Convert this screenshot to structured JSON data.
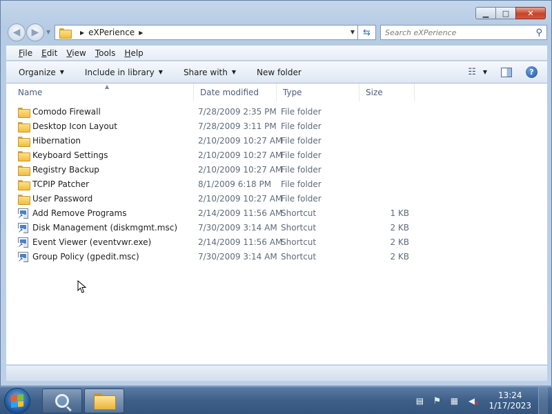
{
  "window": {
    "minimize_glyph": "▁",
    "maximize_glyph": "□",
    "close_glyph": "✕"
  },
  "address_bar": {
    "path": [
      "eXPerience"
    ],
    "search_placeholder": "Search eXPerience"
  },
  "menu": [
    {
      "label": "File",
      "accel": "F",
      "rest": "ile"
    },
    {
      "label": "Edit",
      "accel": "E",
      "rest": "dit"
    },
    {
      "label": "View",
      "accel": "V",
      "rest": "iew"
    },
    {
      "label": "Tools",
      "accel": "T",
      "rest": "ools"
    },
    {
      "label": "Help",
      "accel": "H",
      "rest": "elp"
    }
  ],
  "commands": {
    "organize": "Organize",
    "include_in_library": "Include in library",
    "share_with": "Share with",
    "new_folder": "New folder"
  },
  "columns": {
    "name": "Name",
    "date_modified": "Date modified",
    "type": "Type",
    "size": "Size"
  },
  "files": [
    {
      "name": "Comodo Firewall",
      "date": "7/28/2009 2:35 PM",
      "type": "File folder",
      "size": "",
      "icon": "folder-icon"
    },
    {
      "name": "Desktop Icon Layout",
      "date": "7/28/2009 3:11 PM",
      "type": "File folder",
      "size": "",
      "icon": "folder-icon"
    },
    {
      "name": "Hibernation",
      "date": "2/10/2009 10:27 AM",
      "type": "File folder",
      "size": "",
      "icon": "folder-icon"
    },
    {
      "name": "Keyboard Settings",
      "date": "2/10/2009 10:27 AM",
      "type": "File folder",
      "size": "",
      "icon": "folder-icon"
    },
    {
      "name": "Registry Backup",
      "date": "2/10/2009 10:27 AM",
      "type": "File folder",
      "size": "",
      "icon": "folder-icon"
    },
    {
      "name": "TCPIP Patcher",
      "date": "8/1/2009 6:18 PM",
      "type": "File folder",
      "size": "",
      "icon": "folder-icon"
    },
    {
      "name": "User Password",
      "date": "2/10/2009 10:27 AM",
      "type": "File folder",
      "size": "",
      "icon": "folder-icon"
    },
    {
      "name": "Add Remove Programs",
      "date": "2/14/2009 11:56 AM",
      "type": "Shortcut",
      "size": "1 KB",
      "icon": "shortcut-icon"
    },
    {
      "name": "Disk Management (diskmgmt.msc)",
      "date": "7/30/2009 3:14 AM",
      "type": "Shortcut",
      "size": "2 KB",
      "icon": "shortcut-icon"
    },
    {
      "name": "Event Viewer (eventvwr.exe)",
      "date": "2/14/2009 11:56 AM",
      "type": "Shortcut",
      "size": "2 KB",
      "icon": "shortcut-icon"
    },
    {
      "name": "Group Policy (gpedit.msc)",
      "date": "7/30/2009 3:14 AM",
      "type": "Shortcut",
      "size": "2 KB",
      "icon": "shortcut-icon"
    }
  ],
  "taskbar": {
    "time": "13:24",
    "date": "1/17/2023"
  },
  "colors": {
    "taskbar": "#3d5f88",
    "window_frame": "#b6cbe4",
    "folder": "#f0bd3f"
  }
}
